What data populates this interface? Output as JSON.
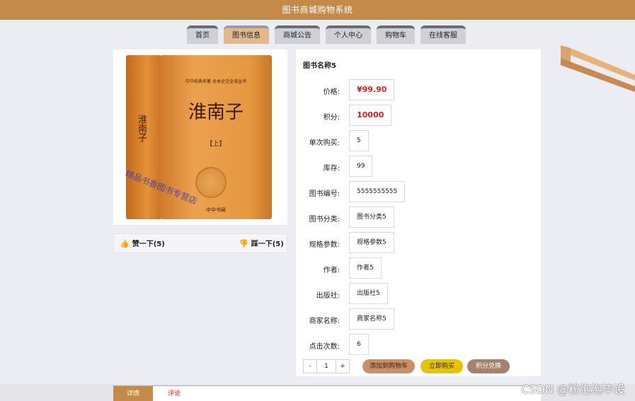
{
  "header": {
    "title": "图书商城购物系统",
    "accent": "#c48a4a"
  },
  "nav": {
    "items": [
      "首页",
      "图书信息",
      "商城公告",
      "个人中心",
      "购物车",
      "在线客服"
    ],
    "active": "图书信息"
  },
  "book_cover": {
    "spine_text": "淮南子",
    "series": "中华经典名著 全本全注全译丛书",
    "title": "淮南子",
    "volume": "【上】",
    "publisher": "中华书局",
    "watermark": "精品书香图书专营店"
  },
  "votes": {
    "up": "赞一下(5)",
    "down": "踩一下(5)"
  },
  "product": {
    "name": "图书名称5",
    "fields": [
      {
        "label": "价格:",
        "value": "¥99.90",
        "highlight": true
      },
      {
        "label": "积分:",
        "value": "10000",
        "highlight": true
      },
      {
        "label": "单次购买:",
        "value": "5",
        "highlight": false
      },
      {
        "label": "库存:",
        "value": "99",
        "highlight": false
      },
      {
        "label": "图书编号:",
        "value": "5555555555",
        "highlight": false
      },
      {
        "label": "图书分类:",
        "value": "图书分类5",
        "highlight": false
      },
      {
        "label": "规格参数:",
        "value": "规格参数5",
        "highlight": false
      },
      {
        "label": "作者:",
        "value": "作者5",
        "highlight": false
      },
      {
        "label": "出版社:",
        "value": "出版社5",
        "highlight": false
      },
      {
        "label": "商家名称:",
        "value": "商家名称5",
        "highlight": false
      },
      {
        "label": "点击次数:",
        "value": "6",
        "highlight": false
      }
    ]
  },
  "quantity": {
    "minus": "-",
    "value": "1",
    "plus": "+"
  },
  "actions": {
    "add_to_cart": "添加到购物车",
    "buy_now": "立即购买",
    "points_exchange": "积分兑换"
  },
  "tabs": {
    "details": "详情",
    "comments": "评论"
  },
  "watermark_text": "CSDN @粉泡泡毕设",
  "colors": {
    "price_red": "#d92020",
    "cart_btn": "#c9906a",
    "buy_btn": "#e8c20a",
    "exchange_btn": "#a6816d"
  }
}
